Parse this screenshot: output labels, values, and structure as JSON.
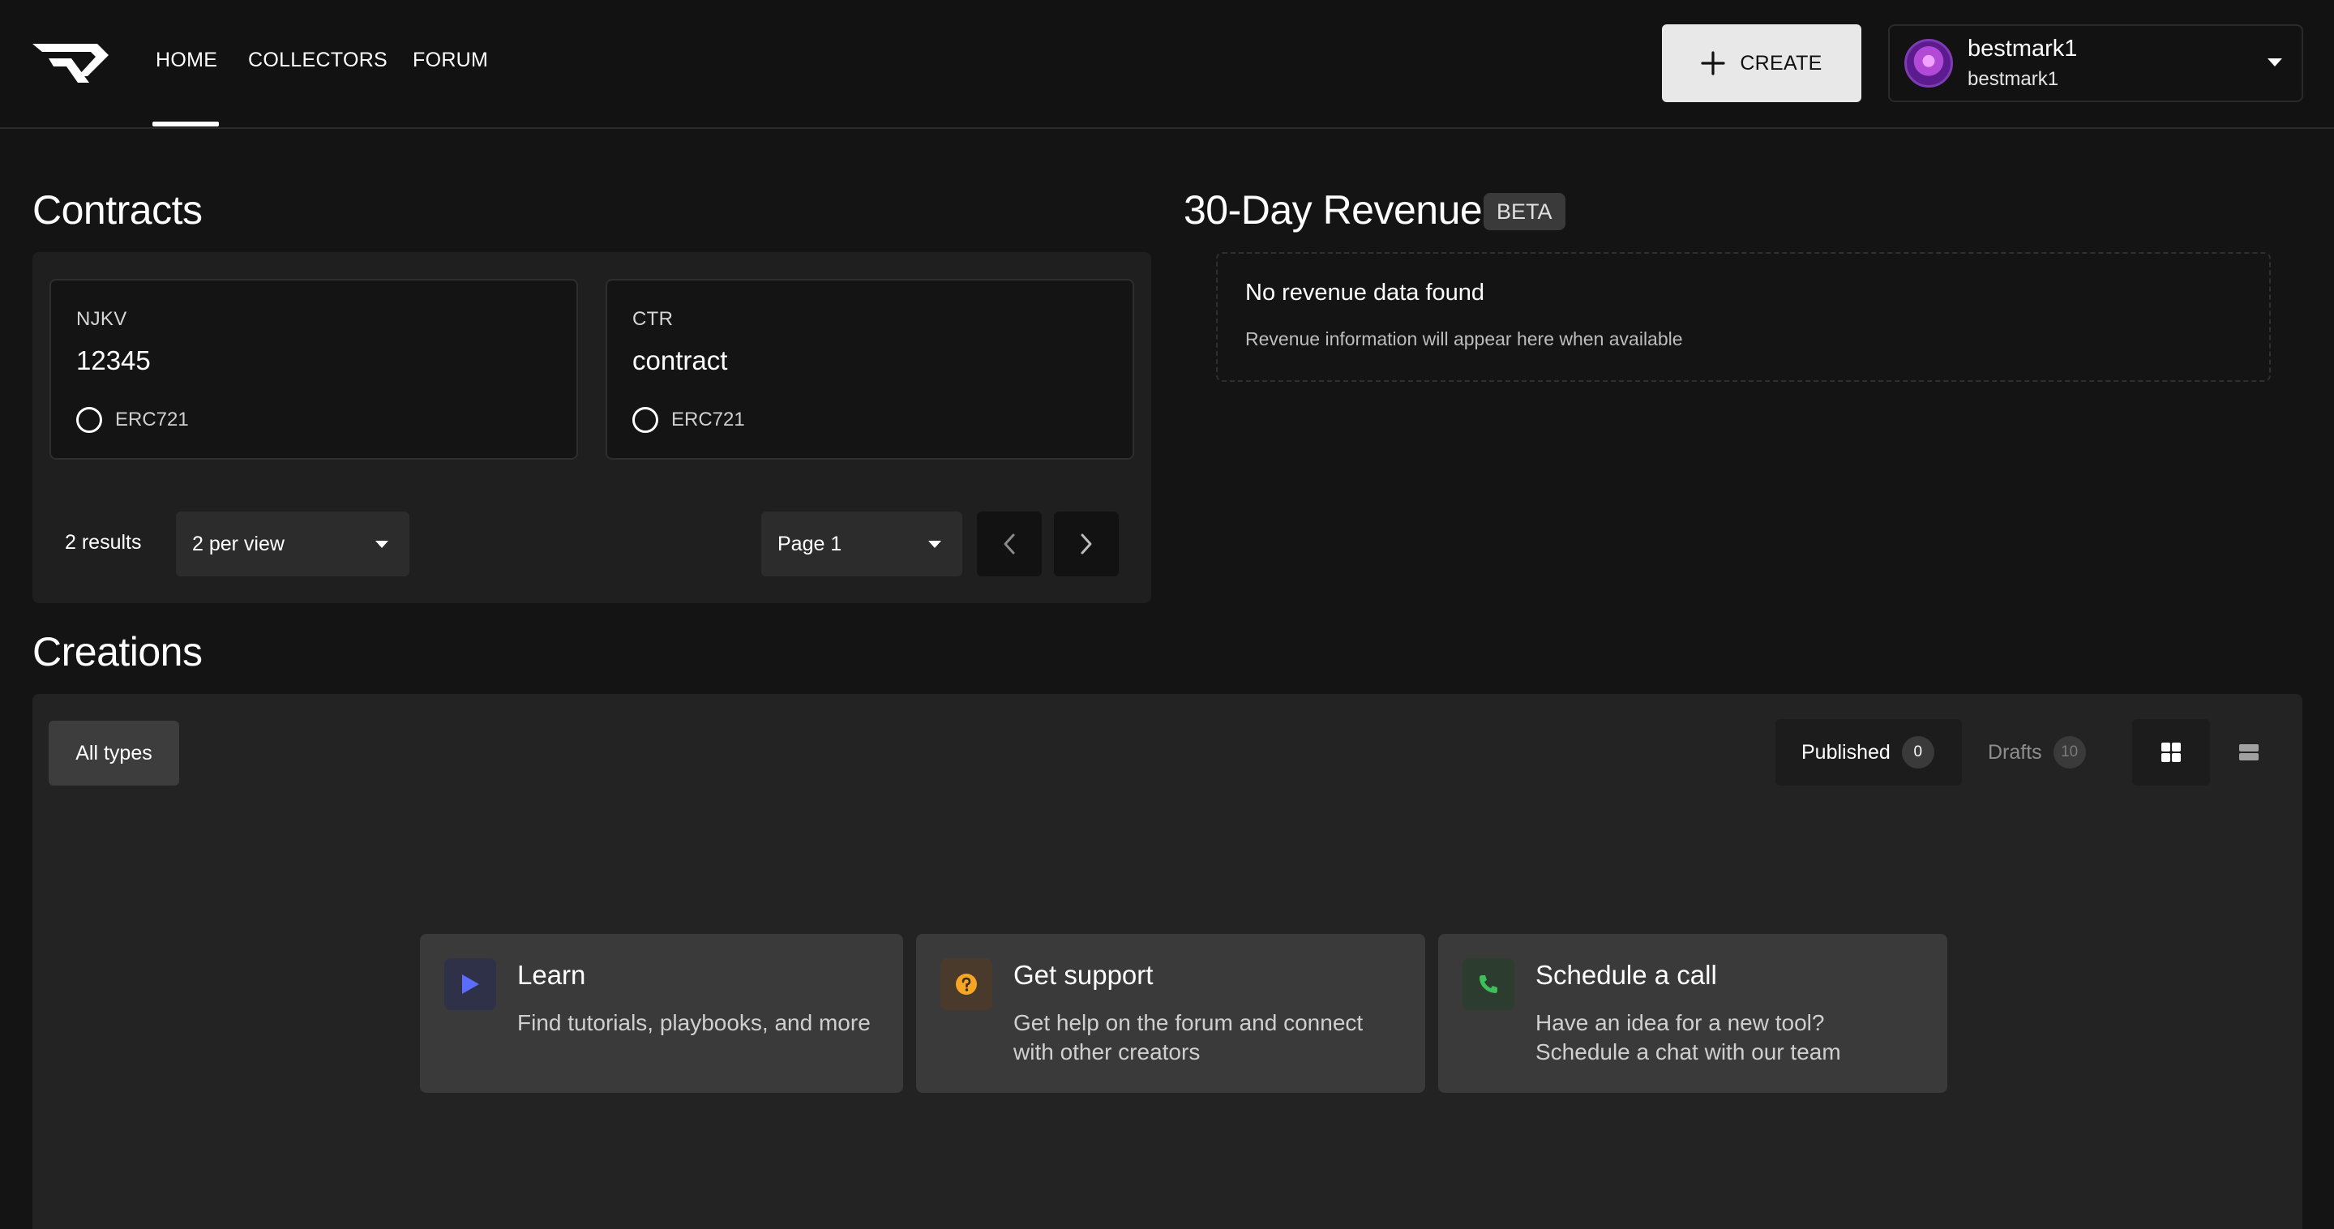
{
  "nav": {
    "items": [
      "HOME",
      "COLLECTORS",
      "FORUM"
    ],
    "active": "HOME"
  },
  "header": {
    "create_label": "CREATE",
    "user": {
      "name": "bestmark1",
      "handle": "bestmark1"
    }
  },
  "contracts": {
    "title": "Contracts",
    "cards": [
      {
        "symbol": "NJKV",
        "name": "12345",
        "type": "ERC721"
      },
      {
        "symbol": "CTR",
        "name": "contract",
        "type": "ERC721"
      }
    ],
    "results_text": "2 results",
    "per_view": "2 per view",
    "page": "Page 1"
  },
  "revenue": {
    "title": "30-Day Revenue",
    "badge": "BETA",
    "empty_title": "No revenue data found",
    "empty_subtitle": "Revenue information will appear here when available"
  },
  "creations": {
    "title": "Creations",
    "type_filter": "All types",
    "tabs": [
      {
        "label": "Published",
        "count": "0"
      },
      {
        "label": "Drafts",
        "count": "10"
      }
    ],
    "help_cards": [
      {
        "title": "Learn",
        "description": "Find tutorials, playbooks, and more",
        "icon": "play-icon"
      },
      {
        "title": "Get support",
        "description": "Get help on the forum and connect\nwith other creators",
        "icon": "question-icon"
      },
      {
        "title": "Schedule a call",
        "description": "Have an idea for a new tool?\nSchedule a chat with our team",
        "icon": "phone-icon"
      }
    ]
  },
  "colors": {
    "background": "#141414",
    "panel": "#1f1f1f",
    "create_button": "#e8e8e8",
    "learn_icon": "#5b6cff",
    "support_icon": "#f5a623",
    "call_icon": "#3fbf5a"
  }
}
